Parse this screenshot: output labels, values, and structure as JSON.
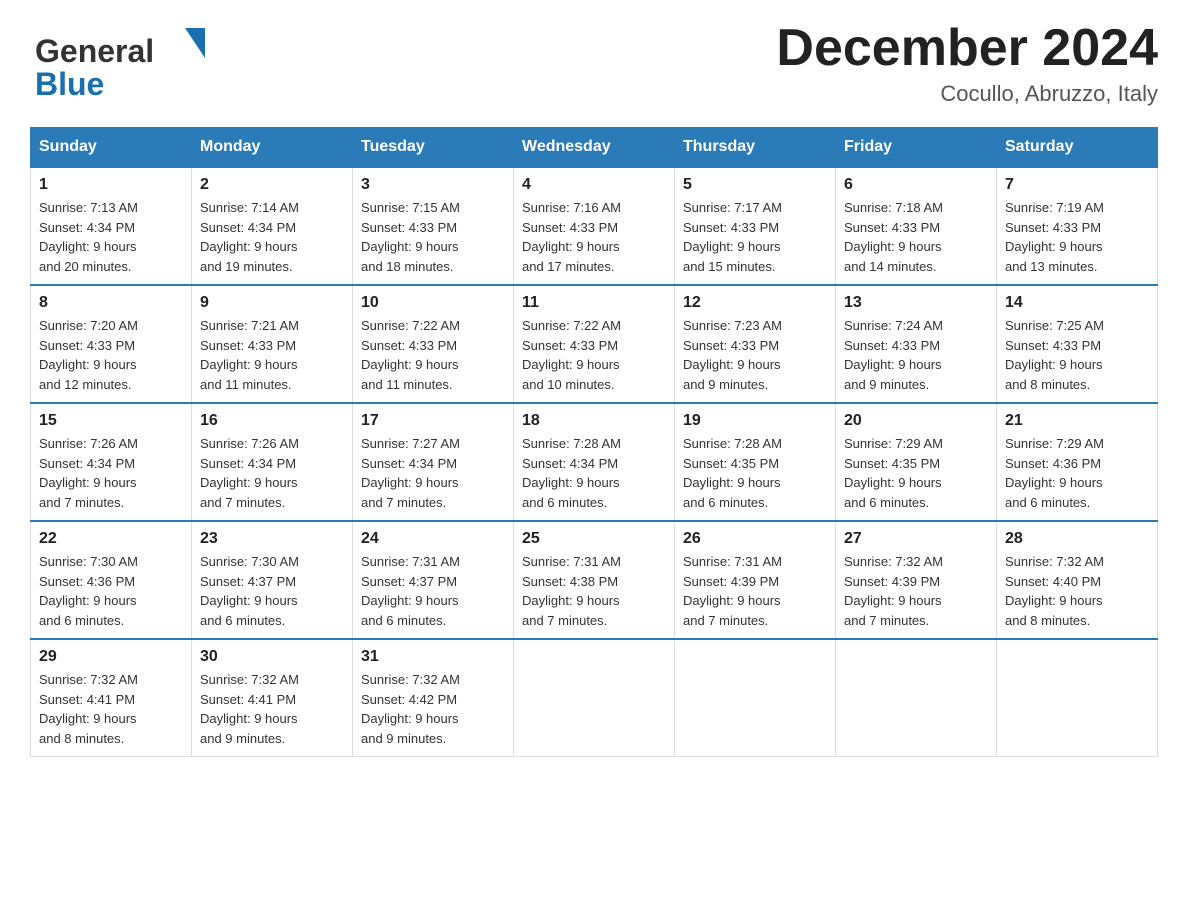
{
  "header": {
    "logo_general": "General",
    "logo_blue": "Blue",
    "title": "December 2024",
    "location": "Cocullo, Abruzzo, Italy"
  },
  "weekdays": [
    "Sunday",
    "Monday",
    "Tuesday",
    "Wednesday",
    "Thursday",
    "Friday",
    "Saturday"
  ],
  "weeks": [
    [
      {
        "day": "1",
        "sunrise": "7:13 AM",
        "sunset": "4:34 PM",
        "daylight": "9 hours and 20 minutes."
      },
      {
        "day": "2",
        "sunrise": "7:14 AM",
        "sunset": "4:34 PM",
        "daylight": "9 hours and 19 minutes."
      },
      {
        "day": "3",
        "sunrise": "7:15 AM",
        "sunset": "4:33 PM",
        "daylight": "9 hours and 18 minutes."
      },
      {
        "day": "4",
        "sunrise": "7:16 AM",
        "sunset": "4:33 PM",
        "daylight": "9 hours and 17 minutes."
      },
      {
        "day": "5",
        "sunrise": "7:17 AM",
        "sunset": "4:33 PM",
        "daylight": "9 hours and 15 minutes."
      },
      {
        "day": "6",
        "sunrise": "7:18 AM",
        "sunset": "4:33 PM",
        "daylight": "9 hours and 14 minutes."
      },
      {
        "day": "7",
        "sunrise": "7:19 AM",
        "sunset": "4:33 PM",
        "daylight": "9 hours and 13 minutes."
      }
    ],
    [
      {
        "day": "8",
        "sunrise": "7:20 AM",
        "sunset": "4:33 PM",
        "daylight": "9 hours and 12 minutes."
      },
      {
        "day": "9",
        "sunrise": "7:21 AM",
        "sunset": "4:33 PM",
        "daylight": "9 hours and 11 minutes."
      },
      {
        "day": "10",
        "sunrise": "7:22 AM",
        "sunset": "4:33 PM",
        "daylight": "9 hours and 11 minutes."
      },
      {
        "day": "11",
        "sunrise": "7:22 AM",
        "sunset": "4:33 PM",
        "daylight": "9 hours and 10 minutes."
      },
      {
        "day": "12",
        "sunrise": "7:23 AM",
        "sunset": "4:33 PM",
        "daylight": "9 hours and 9 minutes."
      },
      {
        "day": "13",
        "sunrise": "7:24 AM",
        "sunset": "4:33 PM",
        "daylight": "9 hours and 9 minutes."
      },
      {
        "day": "14",
        "sunrise": "7:25 AM",
        "sunset": "4:33 PM",
        "daylight": "9 hours and 8 minutes."
      }
    ],
    [
      {
        "day": "15",
        "sunrise": "7:26 AM",
        "sunset": "4:34 PM",
        "daylight": "9 hours and 7 minutes."
      },
      {
        "day": "16",
        "sunrise": "7:26 AM",
        "sunset": "4:34 PM",
        "daylight": "9 hours and 7 minutes."
      },
      {
        "day": "17",
        "sunrise": "7:27 AM",
        "sunset": "4:34 PM",
        "daylight": "9 hours and 7 minutes."
      },
      {
        "day": "18",
        "sunrise": "7:28 AM",
        "sunset": "4:34 PM",
        "daylight": "9 hours and 6 minutes."
      },
      {
        "day": "19",
        "sunrise": "7:28 AM",
        "sunset": "4:35 PM",
        "daylight": "9 hours and 6 minutes."
      },
      {
        "day": "20",
        "sunrise": "7:29 AM",
        "sunset": "4:35 PM",
        "daylight": "9 hours and 6 minutes."
      },
      {
        "day": "21",
        "sunrise": "7:29 AM",
        "sunset": "4:36 PM",
        "daylight": "9 hours and 6 minutes."
      }
    ],
    [
      {
        "day": "22",
        "sunrise": "7:30 AM",
        "sunset": "4:36 PM",
        "daylight": "9 hours and 6 minutes."
      },
      {
        "day": "23",
        "sunrise": "7:30 AM",
        "sunset": "4:37 PM",
        "daylight": "9 hours and 6 minutes."
      },
      {
        "day": "24",
        "sunrise": "7:31 AM",
        "sunset": "4:37 PM",
        "daylight": "9 hours and 6 minutes."
      },
      {
        "day": "25",
        "sunrise": "7:31 AM",
        "sunset": "4:38 PM",
        "daylight": "9 hours and 7 minutes."
      },
      {
        "day": "26",
        "sunrise": "7:31 AM",
        "sunset": "4:39 PM",
        "daylight": "9 hours and 7 minutes."
      },
      {
        "day": "27",
        "sunrise": "7:32 AM",
        "sunset": "4:39 PM",
        "daylight": "9 hours and 7 minutes."
      },
      {
        "day": "28",
        "sunrise": "7:32 AM",
        "sunset": "4:40 PM",
        "daylight": "9 hours and 8 minutes."
      }
    ],
    [
      {
        "day": "29",
        "sunrise": "7:32 AM",
        "sunset": "4:41 PM",
        "daylight": "9 hours and 8 minutes."
      },
      {
        "day": "30",
        "sunrise": "7:32 AM",
        "sunset": "4:41 PM",
        "daylight": "9 hours and 9 minutes."
      },
      {
        "day": "31",
        "sunrise": "7:32 AM",
        "sunset": "4:42 PM",
        "daylight": "9 hours and 9 minutes."
      },
      null,
      null,
      null,
      null
    ]
  ],
  "labels": {
    "sunrise": "Sunrise:",
    "sunset": "Sunset:",
    "daylight": "Daylight:"
  }
}
